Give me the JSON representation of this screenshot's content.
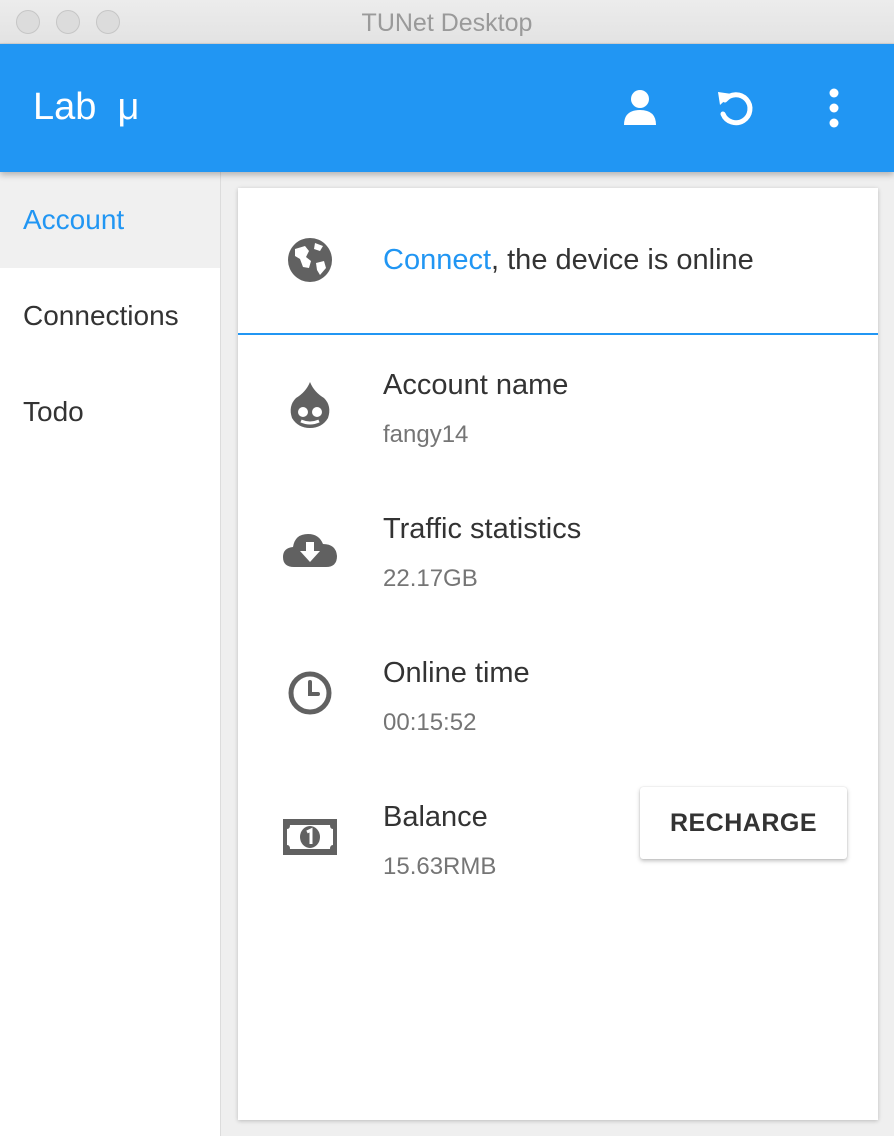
{
  "window": {
    "title": "TUNet Desktop"
  },
  "appbar": {
    "title": "Lab  μ",
    "color": "#2196f3",
    "actions": [
      {
        "icon": "account-icon"
      },
      {
        "icon": "refresh-icon"
      },
      {
        "icon": "more-vert-icon"
      }
    ]
  },
  "sidebar": {
    "items": [
      {
        "label": "Account",
        "active": true
      },
      {
        "label": "Connections",
        "active": false
      },
      {
        "label": "Todo",
        "active": false
      }
    ]
  },
  "status": {
    "icon": "globe-icon",
    "link_label": "Connect",
    "message": ", the device is online"
  },
  "info": [
    {
      "icon": "drupal-icon",
      "label": "Account name",
      "value": "fangy14"
    },
    {
      "icon": "cloud-download-icon",
      "label": "Traffic statistics",
      "value": "22.17GB"
    },
    {
      "icon": "clock-icon",
      "label": "Online time",
      "value": "00:15:52"
    },
    {
      "icon": "money-icon",
      "label": "Balance",
      "value": "15.63RMB"
    }
  ],
  "recharge_label": "RECHARGE"
}
